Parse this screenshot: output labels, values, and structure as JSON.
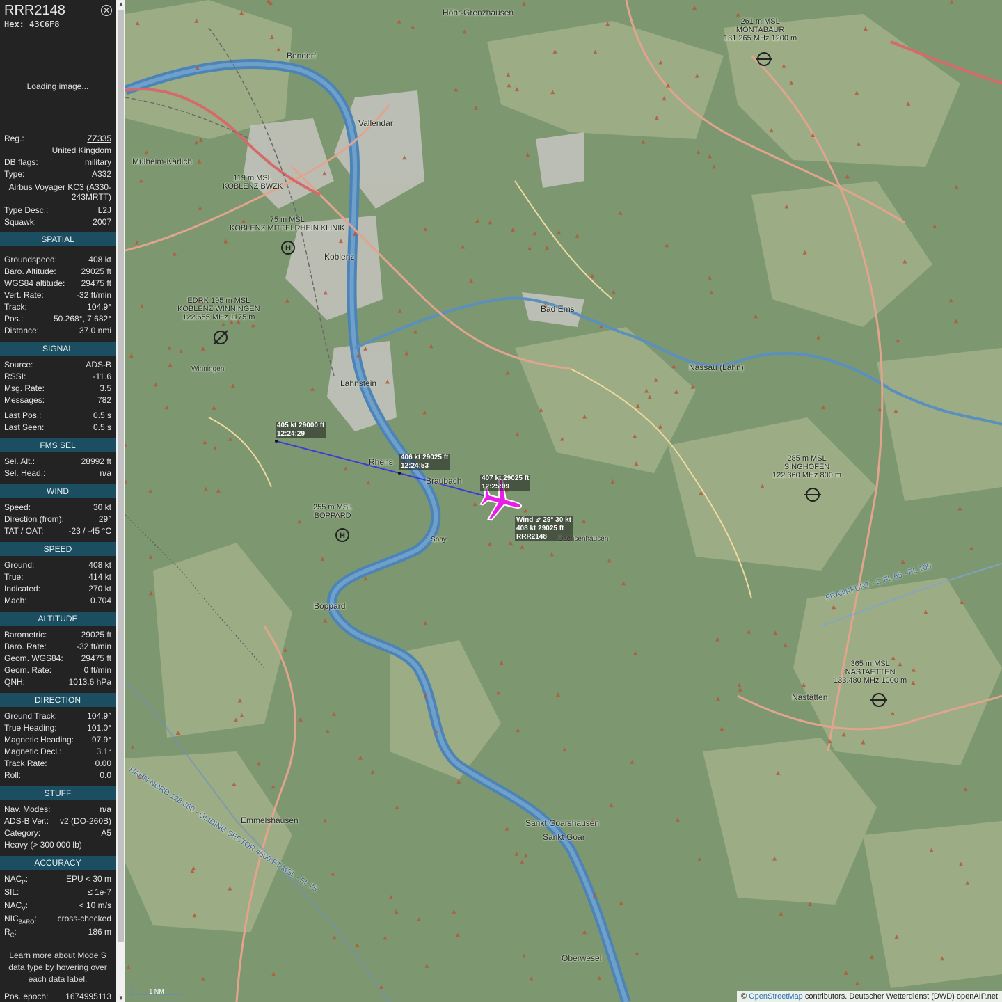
{
  "header": {
    "callsign": "RRR2148",
    "hex": "Hex: 43C6F8",
    "close_icon": "close-circle-icon"
  },
  "image": {
    "loading": "Loading image..."
  },
  "info": [
    {
      "k": "Reg.:",
      "v": "ZZ335"
    },
    {
      "k": "",
      "v": "United Kingdom"
    },
    {
      "k": "DB flags:",
      "v": "military"
    },
    {
      "k": "Type:",
      "v": "A332"
    },
    {
      "k": "",
      "v": "Airbus Voyager KC3 (A330-243MRTT)"
    },
    {
      "k": "Type Desc.:",
      "v": "L2J"
    },
    {
      "k": "Squawk:",
      "v": "2007"
    }
  ],
  "sections": {
    "spatial": "SPATIAL",
    "signal": "SIGNAL",
    "fms": "FMS SEL",
    "wind": "WIND",
    "speed": "SPEED",
    "altitude": "ALTITUDE",
    "direction": "DIRECTION",
    "stuff": "STUFF",
    "accuracy": "ACCURACY"
  },
  "spatial": [
    {
      "k": "Groundspeed:",
      "v": "408 kt"
    },
    {
      "k": "Baro. Altitude:",
      "v": "29025 ft"
    },
    {
      "k": "WGS84 altitude:",
      "v": "29475 ft"
    },
    {
      "k": "Vert. Rate:",
      "v": "-32 ft/min"
    },
    {
      "k": "Track:",
      "v": "104.9°"
    },
    {
      "k": "Pos.:",
      "v": "50.268°, 7.682°"
    },
    {
      "k": "Distance:",
      "v": "37.0 nmi"
    }
  ],
  "signal": [
    {
      "k": "Source:",
      "v": "ADS-B"
    },
    {
      "k": "RSSI:",
      "v": "-11.6"
    },
    {
      "k": "Msg. Rate:",
      "v": "3.5"
    },
    {
      "k": "Messages:",
      "v": "782"
    },
    {
      "k": "Last Pos.:",
      "v": "0.5 s"
    },
    {
      "k": "Last Seen:",
      "v": "0.5 s"
    }
  ],
  "fms": [
    {
      "k": "Sel. Alt.:",
      "v": "28992 ft"
    },
    {
      "k": "Sel. Head.:",
      "v": "n/a"
    }
  ],
  "wind": [
    {
      "k": "Speed:",
      "v": "30 kt"
    },
    {
      "k": "Direction (from):",
      "v": "29°"
    },
    {
      "k": "TAT / OAT:",
      "v": "-23 / -45 °C"
    }
  ],
  "speed": [
    {
      "k": "Ground:",
      "v": "408 kt"
    },
    {
      "k": "True:",
      "v": "414 kt"
    },
    {
      "k": "Indicated:",
      "v": "270 kt"
    },
    {
      "k": "Mach:",
      "v": "0.704"
    }
  ],
  "altitude": [
    {
      "k": "Barometric:",
      "v": "29025 ft"
    },
    {
      "k": "Baro. Rate:",
      "v": "-32 ft/min"
    },
    {
      "k": "Geom. WGS84:",
      "v": "29475 ft"
    },
    {
      "k": "Geom. Rate:",
      "v": "0 ft/min"
    },
    {
      "k": "QNH:",
      "v": "1013.6 hPa"
    }
  ],
  "direction": [
    {
      "k": "Ground Track:",
      "v": "104.9°"
    },
    {
      "k": "True Heading:",
      "v": "101.0°"
    },
    {
      "k": "Magnetic Heading:",
      "v": "97.9°"
    },
    {
      "k": "Magnetic Decl.:",
      "v": "3.1°"
    },
    {
      "k": "Track Rate:",
      "v": "0.00"
    },
    {
      "k": "Roll:",
      "v": "0.0"
    }
  ],
  "stuff": [
    {
      "k": "Nav. Modes:",
      "v": "n/a"
    },
    {
      "k": "ADS-B Ver.:",
      "v": "v2 (DO-260B)"
    },
    {
      "k": "Category:",
      "v": "A5"
    },
    {
      "k": "Heavy (> 300 000 lb)",
      "v": ""
    }
  ],
  "accuracy": [
    {
      "k": "NAC",
      "sub": "P",
      "v": "EPU < 30 m"
    },
    {
      "k": "SIL:",
      "sub": "",
      "v": "≤ 1e-7"
    },
    {
      "k": "NAC",
      "sub": "V",
      "v": "< 10 m/s"
    },
    {
      "k": "NIC",
      "sub": "BARO",
      "v": "cross-checked"
    },
    {
      "k": "R",
      "sub": "C",
      "v": "186 m"
    }
  ],
  "footer": {
    "learn_more": "Learn more about Mode S data type by hovering over each data label.",
    "epoch_k": "Pos. epoch:",
    "epoch_v": "1674995113"
  },
  "map": {
    "track_labels": [
      {
        "l1": "405 kt  29000 ft",
        "l2": "12:24:29"
      },
      {
        "l1": "406 kt  29025 ft",
        "l2": "12:24:53"
      },
      {
        "l1": "407 kt  29025 ft",
        "l2": "12:25:09"
      }
    ],
    "aircraft_label": {
      "l1": "Wind ⬃ 29° 30 kt",
      "l2": "408 kt  29025 ft",
      "l3": "RRR2148"
    },
    "airfields": [
      {
        "l1": "261 m MSL",
        "l2": "MONTABAUR",
        "l3": "131.265 MHz 1200 m"
      },
      {
        "l1": "EDRK 195 m MSL",
        "l2": "KOBLENZ WINNINGEN",
        "l3": "122.655 MHz 1175 m"
      },
      {
        "l1": "285 m MSL",
        "l2": "SINGHOFEN",
        "l3": "122.360 MHz 800 m"
      },
      {
        "l1": "365 m MSL",
        "l2": "NASTAETTEN",
        "l3": "133.480 MHz 1000 m"
      },
      {
        "l1": "119 m MSL",
        "l2": "KOBLENZ BWZK",
        "l3": ""
      },
      {
        "l1": "75 m MSL",
        "l2": "KOBLENZ MITTELRHEIN KLINIK",
        "l3": ""
      },
      {
        "l1": "255 m MSL",
        "l2": "BOPPARD",
        "l3": ""
      }
    ],
    "towns": {
      "hohr": "Höhr-Grenzhausen",
      "bendorf": "Bendorf",
      "vallendar": "Vallendar",
      "koblenz": "Koblenz",
      "lahnstein": "Lahnstein",
      "rhens": "Rhens",
      "braubach": "Braubach",
      "boppard": "Boppard",
      "badems": "Bad Ems",
      "nassau": "Nassau (Lahn)",
      "nastatten": "Nastätten",
      "stgoar": "Sankt Goarshausen",
      "stgoar2": "Sankt Goar",
      "oberwesel": "Oberwesel",
      "emmelshausen": "Emmelshausen",
      "mulheim": "Mülheim-Kärlich",
      "montabaur": "Montabaur",
      "winningen": "Winningen",
      "spay": "Spay",
      "dachsen": "Dachsenhausen",
      "frankfurt": "FRANKFURT - C FL 65 - FL 100",
      "gliding": "HAHN NORD 128.360 - GLIDING SECTOR 4500 FT MSL - FL 75"
    },
    "scale": "1 NM",
    "attribution_pre": "© ",
    "attribution_link": "OpenStreetMap",
    "attribution_post": " contributors. Deutscher Wetterdienst (DWD) openAIP.net"
  }
}
